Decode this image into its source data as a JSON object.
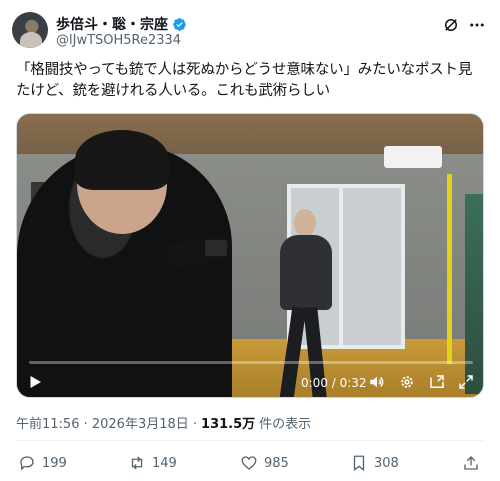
{
  "author": {
    "display_name": "歩倍斗・聡・宗座",
    "handle": "@lJwTSOH5Re2334",
    "verified_color": "#1d9bf0"
  },
  "icons": {
    "grok": "grok-icon",
    "more": "more-icon",
    "verified": "verified-badge-icon"
  },
  "tweet": {
    "text": "「格闘技やっても銃で人は死ぬからどうせ意味ない」みたいなポスト見たけど、銃を避けれる人いる。これも武術らしい"
  },
  "video": {
    "time": "0:00 / 0:32",
    "progress": 0
  },
  "meta": {
    "timestamp": "午前11:56 · 2026年3月18日 ·",
    "views_count": "131.5万",
    "views_label": "件の表示"
  },
  "actions": {
    "replies": "199",
    "retweets": "149",
    "likes": "985",
    "bookmarks": "308"
  }
}
